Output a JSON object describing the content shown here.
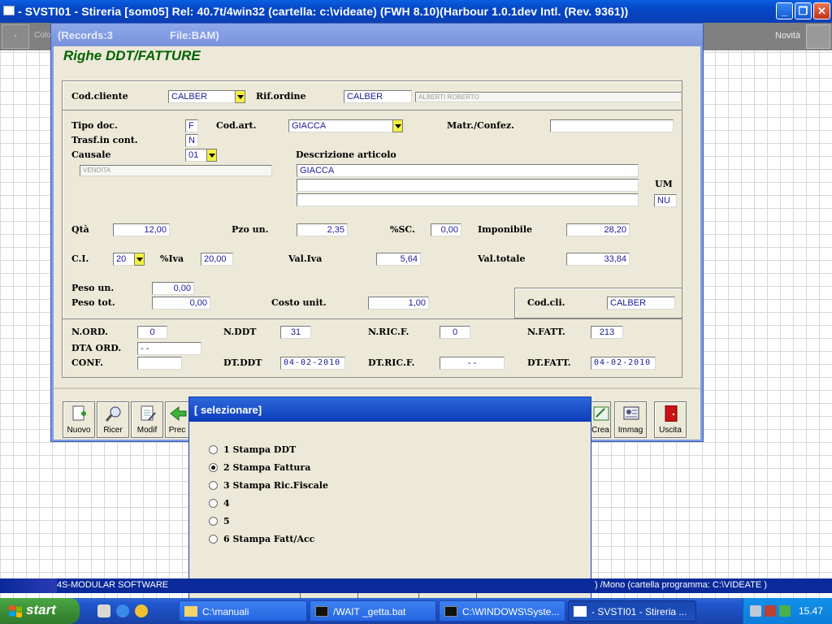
{
  "app": {
    "title": "- SVSTI01 - Stireria       [som05]     Rel: 40.7t/4win32          (cartella: c:\\videate) (FWH 8.10)(Harbour 1.0.1dev Intl. (Rev. 9361))",
    "bg_left_text": "Colo",
    "bg_right_text": "Novità"
  },
  "inner_window": {
    "records": "(Records:3",
    "file": "File:BAM)",
    "form_title": "Righe DDT/FATTURE"
  },
  "form": {
    "cod_cliente": {
      "label": "Cod.cliente",
      "value": "CALBER"
    },
    "rif_ordine": {
      "label": "Rif.ordine",
      "value": "CALBER",
      "name": "ALBERTI ROBERTO"
    },
    "tipo_doc": {
      "label": "Tipo doc.",
      "value": "F"
    },
    "cod_art": {
      "label": "Cod.art.",
      "value": "GIACCA"
    },
    "matr_confez": {
      "label": "Matr./Confez.",
      "value": ""
    },
    "trasf_cont": {
      "label": "Trasf.in cont.",
      "value": "N"
    },
    "causale": {
      "label": "Causale",
      "value": "01",
      "desc": "VENDITA"
    },
    "descrizione": {
      "label": "Descrizione articolo",
      "line1": "GIACCA",
      "line2": "",
      "line3": ""
    },
    "um": {
      "label": "UM",
      "value": "NU"
    },
    "qta": {
      "label": "Qtà",
      "value": "12,00"
    },
    "pzo_un": {
      "label": "Pzo un.",
      "value": "2,35"
    },
    "sconto": {
      "label": "%SC.",
      "value": "0,00"
    },
    "imponibile": {
      "label": "Imponibile",
      "value": "28,20"
    },
    "ci": {
      "label": "C.I.",
      "value": "20"
    },
    "iva_perc": {
      "label": "%Iva",
      "value": "20,00"
    },
    "val_iva": {
      "label": "Val.Iva",
      "value": "5,64"
    },
    "val_totale": {
      "label": "Val.totale",
      "value": "33,84"
    },
    "peso_un": {
      "label": "Peso un.",
      "value": "0,00"
    },
    "peso_tot": {
      "label": "Peso tot.",
      "value": "0,00"
    },
    "costo_unit": {
      "label": "Costo unit.",
      "value": "1,00"
    },
    "cod_cli": {
      "label": "Cod.cli.",
      "value": "CALBER"
    },
    "n_ord": {
      "label": "N.ORD.",
      "value": "0"
    },
    "n_ddt": {
      "label": "N.DDT",
      "value": "31"
    },
    "n_ric_f": {
      "label": "N.RIC.F.",
      "value": "0"
    },
    "n_fatt": {
      "label": "N.FATT.",
      "value": "213"
    },
    "dta_ord": {
      "label": "DTA ORD.",
      "value": "-  -"
    },
    "conf": {
      "label": "CONF.",
      "value": ""
    },
    "dt_ddt": {
      "label": "DT.DDT",
      "value": "04-02-2010"
    },
    "dt_ric_f": {
      "label": "DT.RIC.F.",
      "value": "-  -"
    },
    "dt_fatt": {
      "label": "DT.FATT.",
      "value": "04-02-2010"
    }
  },
  "toolbar": {
    "nuovo": "Nuovo",
    "ricer": "Ricer",
    "modif": "Modif",
    "prec": "Prec",
    "crea": "Crea",
    "immag": "Immag",
    "uscita": "Uscita"
  },
  "dialog": {
    "title": "[ selezionare]",
    "options": [
      {
        "label": "1 Stampa DDT",
        "selected": false
      },
      {
        "label": "2 Stampa Fattura",
        "selected": true
      },
      {
        "label": "3 Stampa Ric.Fiscale",
        "selected": false
      },
      {
        "label": "4",
        "selected": false
      },
      {
        "label": "5",
        "selected": false
      },
      {
        "label": "6 Stampa Fatt/Acc",
        "selected": false
      }
    ]
  },
  "status_bar": {
    "left_text": "4S-MODULAR SOFTWARE",
    "right_text": ") /Mono  (cartella programma: C:\\VIDEATE )"
  },
  "taskbar": {
    "start_label": "start",
    "items": [
      {
        "label": "C:\\manuali",
        "active": false
      },
      {
        "label": "/WAIT _getta.bat",
        "active": false
      },
      {
        "label": "C:\\WINDOWS\\Syste...",
        "active": false
      },
      {
        "label": "- SVSTI01 - Stireria    ...",
        "active": true
      }
    ],
    "clock": "15.47"
  },
  "colors": {
    "xp_blue": "#0546c6",
    "form_title_green": "#006400",
    "field_text_blue": "#1a1a9a",
    "dropdown_yellow": "#f3f040",
    "start_green": "#3a8a33"
  }
}
